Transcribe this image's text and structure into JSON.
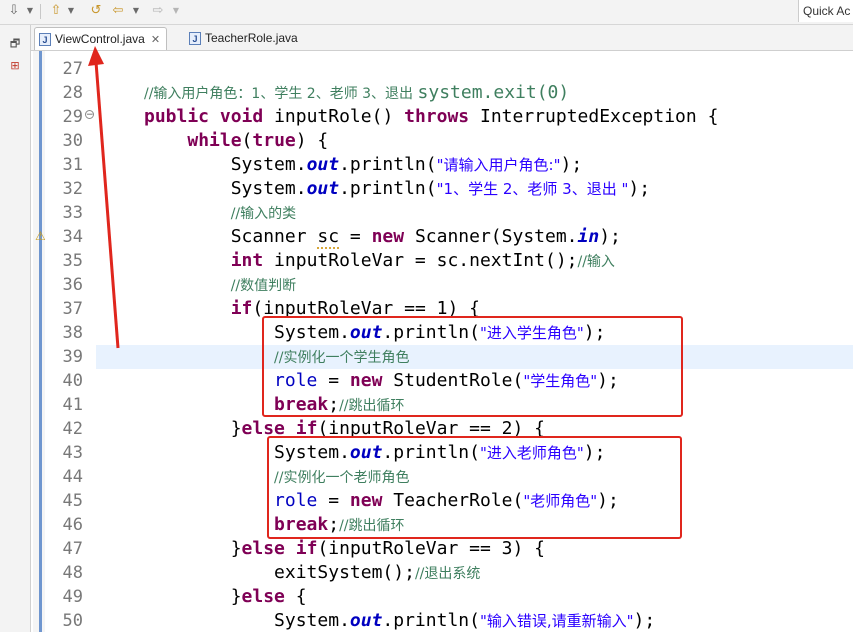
{
  "toolbar": {
    "icons": [
      "download-icon",
      "dropdown-icon",
      "up-arrow-icon",
      "nav-back-icon",
      "back-arrow-icon",
      "forward-arrow-icon"
    ],
    "quick_access": "Quick Ac"
  },
  "tabs": [
    {
      "label": "ViewControl.java",
      "active": true
    },
    {
      "label": "TeacherRole.java",
      "active": false
    }
  ],
  "colors": {
    "keyword": "#7f0055",
    "static_field": "#0000c0",
    "string": "#2a00ff",
    "comment": "#3f7f5f",
    "annotation_red": "#e0261d",
    "line_highlight": "#e8f2fe"
  },
  "editor": {
    "lines": [
      {
        "n": "27",
        "segs": []
      },
      {
        "n": "28",
        "segs": [
          {
            "t": "//输入用户角色：1、学生 2、老师 3、退出 ",
            "c": "cmt cmt-cn"
          },
          {
            "t": "system.exit(0)",
            "c": "cmt"
          }
        ]
      },
      {
        "n": "29",
        "segs": [
          {
            "t": "public",
            "c": "kw"
          },
          {
            "t": " "
          },
          {
            "t": "void",
            "c": "kw"
          },
          {
            "t": " inputRole() "
          },
          {
            "t": "throws",
            "c": "kw"
          },
          {
            "t": " InterruptedException {"
          }
        ]
      },
      {
        "n": "30",
        "segs": [
          {
            "t": "    "
          },
          {
            "t": "while",
            "c": "kw"
          },
          {
            "t": "("
          },
          {
            "t": "true",
            "c": "kw"
          },
          {
            "t": ") {"
          }
        ]
      },
      {
        "n": "31",
        "segs": [
          {
            "t": "        System."
          },
          {
            "t": "out",
            "c": "fld"
          },
          {
            "t": ".println("
          },
          {
            "t": "\"请输入用户角色:\"",
            "c": "str str-cn"
          },
          {
            "t": ");"
          }
        ]
      },
      {
        "n": "32",
        "segs": [
          {
            "t": "        System."
          },
          {
            "t": "out",
            "c": "fld"
          },
          {
            "t": ".println("
          },
          {
            "t": "\"1、学生 2、老师 3、退出 \"",
            "c": "str str-cn"
          },
          {
            "t": ");"
          }
        ]
      },
      {
        "n": "33",
        "segs": [
          {
            "t": "        "
          },
          {
            "t": "//输入的类",
            "c": "cmt cmt-cn"
          }
        ]
      },
      {
        "n": "34",
        "segs": [
          {
            "t": "        Scanner "
          },
          {
            "t": "sc",
            "c": "squiggle"
          },
          {
            "t": " = "
          },
          {
            "t": "new",
            "c": "kw"
          },
          {
            "t": " Scanner(System."
          },
          {
            "t": "in",
            "c": "fld"
          },
          {
            "t": ");"
          }
        ]
      },
      {
        "n": "35",
        "segs": [
          {
            "t": "        "
          },
          {
            "t": "int",
            "c": "kw"
          },
          {
            "t": " inputRoleVar = sc.nextInt();"
          },
          {
            "t": "//输入",
            "c": "cmt cmt-cn"
          }
        ]
      },
      {
        "n": "36",
        "segs": [
          {
            "t": "        "
          },
          {
            "t": "//数值判断",
            "c": "cmt cmt-cn"
          }
        ]
      },
      {
        "n": "37",
        "segs": [
          {
            "t": "        "
          },
          {
            "t": "if",
            "c": "kw"
          },
          {
            "t": "(inputRoleVar == 1) {"
          }
        ]
      },
      {
        "n": "38",
        "segs": [
          {
            "t": "            System."
          },
          {
            "t": "out",
            "c": "fld"
          },
          {
            "t": ".println("
          },
          {
            "t": "\"进入学生角色\"",
            "c": "str str-cn"
          },
          {
            "t": ");"
          }
        ]
      },
      {
        "n": "39",
        "segs": [
          {
            "t": "            "
          },
          {
            "t": "//实例化一个学生角色",
            "c": "cmt cmt-cn"
          }
        ]
      },
      {
        "n": "40",
        "segs": [
          {
            "t": "            "
          },
          {
            "t": "role",
            "c": "fld-plain"
          },
          {
            "t": " = "
          },
          {
            "t": "new",
            "c": "kw"
          },
          {
            "t": " StudentRole("
          },
          {
            "t": "\"学生角色\"",
            "c": "str str-cn"
          },
          {
            "t": ");"
          }
        ]
      },
      {
        "n": "41",
        "segs": [
          {
            "t": "            "
          },
          {
            "t": "break",
            "c": "kw"
          },
          {
            "t": ";"
          },
          {
            "t": "//跳出循环",
            "c": "cmt cmt-cn"
          }
        ]
      },
      {
        "n": "42",
        "segs": [
          {
            "t": "        }"
          },
          {
            "t": "else",
            "c": "kw"
          },
          {
            "t": " "
          },
          {
            "t": "if",
            "c": "kw"
          },
          {
            "t": "(inputRoleVar == 2) {"
          }
        ]
      },
      {
        "n": "43",
        "segs": [
          {
            "t": "            System."
          },
          {
            "t": "out",
            "c": "fld"
          },
          {
            "t": ".println("
          },
          {
            "t": "\"进入老师角色\"",
            "c": "str str-cn"
          },
          {
            "t": ");"
          }
        ]
      },
      {
        "n": "44",
        "segs": [
          {
            "t": "            "
          },
          {
            "t": "//实例化一个老师角色",
            "c": "cmt cmt-cn"
          }
        ]
      },
      {
        "n": "45",
        "segs": [
          {
            "t": "            "
          },
          {
            "t": "role",
            "c": "fld-plain"
          },
          {
            "t": " = "
          },
          {
            "t": "new",
            "c": "kw"
          },
          {
            "t": " TeacherRole("
          },
          {
            "t": "\"老师角色\"",
            "c": "str str-cn"
          },
          {
            "t": ");"
          }
        ]
      },
      {
        "n": "46",
        "segs": [
          {
            "t": "            "
          },
          {
            "t": "break",
            "c": "kw"
          },
          {
            "t": ";"
          },
          {
            "t": "//跳出循环",
            "c": "cmt cmt-cn"
          }
        ]
      },
      {
        "n": "47",
        "segs": [
          {
            "t": "        }"
          },
          {
            "t": "else",
            "c": "kw"
          },
          {
            "t": " "
          },
          {
            "t": "if",
            "c": "kw"
          },
          {
            "t": "(inputRoleVar == 3) {"
          }
        ]
      },
      {
        "n": "48",
        "segs": [
          {
            "t": "            exitSystem();"
          },
          {
            "t": "//退出系统",
            "c": "cmt cmt-cn"
          }
        ]
      },
      {
        "n": "49",
        "segs": [
          {
            "t": "        }"
          },
          {
            "t": "else",
            "c": "kw"
          },
          {
            "t": " {"
          }
        ]
      },
      {
        "n": "50",
        "segs": [
          {
            "t": "            System."
          },
          {
            "t": "out",
            "c": "fld"
          },
          {
            "t": ".println("
          },
          {
            "t": "\"输入错误,请重新输入\"",
            "c": "str str-cn"
          },
          {
            "t": ");"
          }
        ]
      }
    ]
  }
}
